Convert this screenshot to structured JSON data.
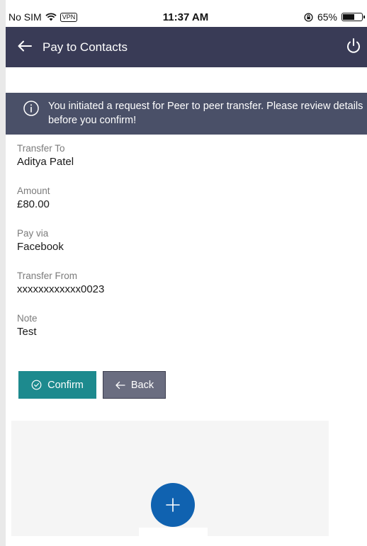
{
  "status_bar": {
    "carrier": "No SIM",
    "vpn": "VPN",
    "time": "11:37 AM",
    "battery_percent": "65%",
    "battery_level": 0.65
  },
  "app_bar": {
    "title": "Pay to Contacts",
    "back_icon": "arrow-left-icon",
    "power_icon": "power-icon",
    "color": "#393b56"
  },
  "banner": {
    "icon": "info-icon",
    "message": "You initiated a request for Peer to peer transfer. Please review details before you confirm!",
    "color": "#4a5068"
  },
  "details": [
    {
      "label": "Transfer To",
      "value": "Aditya Patel"
    },
    {
      "label": "Amount",
      "value": "£80.00"
    },
    {
      "label": "Pay via",
      "value": "Facebook"
    },
    {
      "label": "Transfer From",
      "value": "xxxxxxxxxxxx0023"
    },
    {
      "label": "Note",
      "value": "Test"
    }
  ],
  "actions": {
    "confirm_label": "Confirm",
    "confirm_icon": "check-circle-icon",
    "confirm_color": "#1d8a8e",
    "back_label": "Back",
    "back_icon": "arrow-left-icon",
    "back_color": "#6a6d80"
  },
  "fab": {
    "icon": "plus-icon",
    "color": "#1062b0"
  }
}
